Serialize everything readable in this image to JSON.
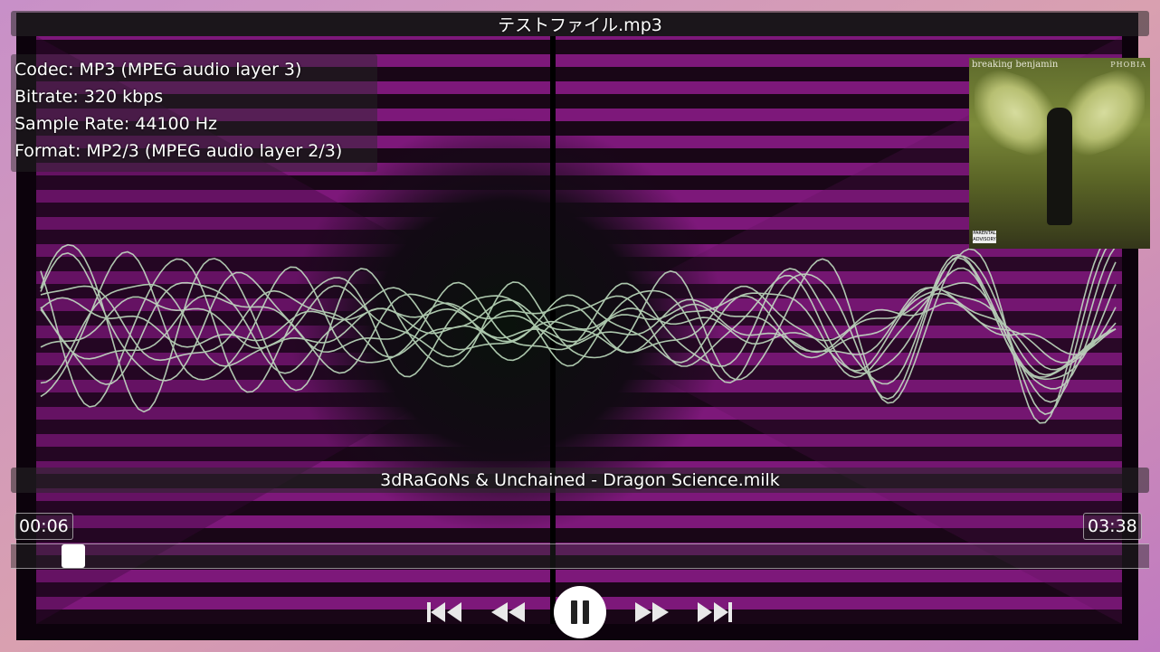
{
  "title": "テストファイル.mp3",
  "info": {
    "codec": "Codec: MP3 (MPEG audio layer 3)",
    "bitrate": "Bitrate: 320 kbps",
    "sample_rate": "Sample Rate: 44100 Hz",
    "format": "Format: MP2/3 (MPEG audio layer 2/3)"
  },
  "album_art": {
    "band": "breaking benjamin",
    "album": "PHOBIA",
    "label": "PARENTAL ADVISORY"
  },
  "preset": "3dRaGoNs & Unchained - Dragon Science.milk",
  "time": {
    "elapsed": "00:06",
    "total": "03:38"
  },
  "progress": 0.0275,
  "controls": {
    "skip_back": "skip-to-start-icon",
    "rewind": "rewind-icon",
    "pause": "pause-icon",
    "forward": "fast-forward-icon",
    "skip_forward": "skip-to-end-icon"
  },
  "colors": {
    "magenta": "#8a1a86",
    "wave": "#c8e8c8",
    "frame": "#c07ab8"
  }
}
